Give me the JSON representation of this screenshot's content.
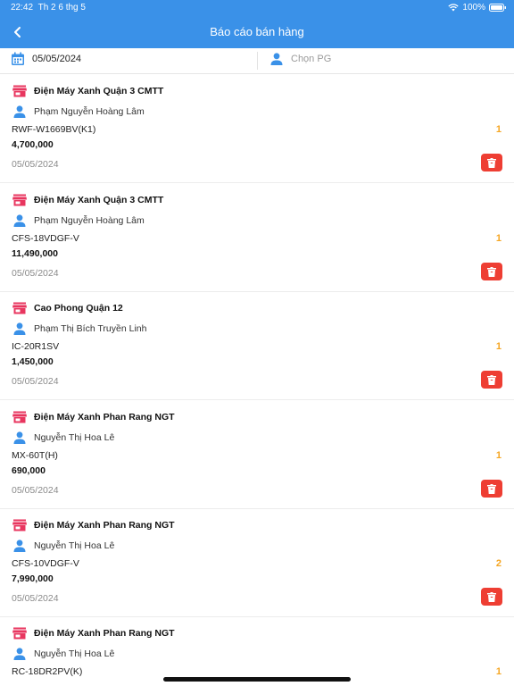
{
  "status_bar": {
    "time": "22:42",
    "date": "Th 2 6 thg 5",
    "battery": "100%"
  },
  "header": {
    "title": "Báo cáo bán hàng"
  },
  "filters": {
    "date": "05/05/2024",
    "pg_placeholder": "Chọn PG"
  },
  "colors": {
    "header_bg": "#3a91e8",
    "store_icon": "#e8365f",
    "person_icon": "#3a91e8",
    "quantity": "#f5a623",
    "delete": "#ee3e33"
  },
  "items": [
    {
      "store": "Điện Máy Xanh Quận 3 CMTT",
      "person": "Phạm Nguyễn Hoàng Lâm",
      "product": "RWF-W1669BV(K1)",
      "price": "4,700,000",
      "date": "05/05/2024",
      "quantity": "1"
    },
    {
      "store": "Điện Máy Xanh Quận 3 CMTT",
      "person": "Phạm Nguyễn Hoàng Lâm",
      "product": "CFS-18VDGF-V",
      "price": "11,490,000",
      "date": "05/05/2024",
      "quantity": "1"
    },
    {
      "store": "Cao Phong Quận 12",
      "person": "Phạm Thị Bích Truyền Linh",
      "product": "IC-20R1SV",
      "price": "1,450,000",
      "date": "05/05/2024",
      "quantity": "1"
    },
    {
      "store": "Điện Máy Xanh Phan Rang NGT",
      "person": "Nguyễn Thị Hoa Lê",
      "product": "MX-60T(H)",
      "price": "690,000",
      "date": "05/05/2024",
      "quantity": "1"
    },
    {
      "store": "Điện Máy Xanh Phan Rang NGT",
      "person": "Nguyễn Thị Hoa Lê",
      "product": "CFS-10VDGF-V",
      "price": "7,990,000",
      "date": "05/05/2024",
      "quantity": "2"
    },
    {
      "store": "Điện Máy Xanh Phan Rang NGT",
      "person": "Nguyễn Thị Hoa Lê",
      "product": "RC-18DR2PV(K)",
      "price": "",
      "date": "",
      "quantity": "1"
    }
  ]
}
